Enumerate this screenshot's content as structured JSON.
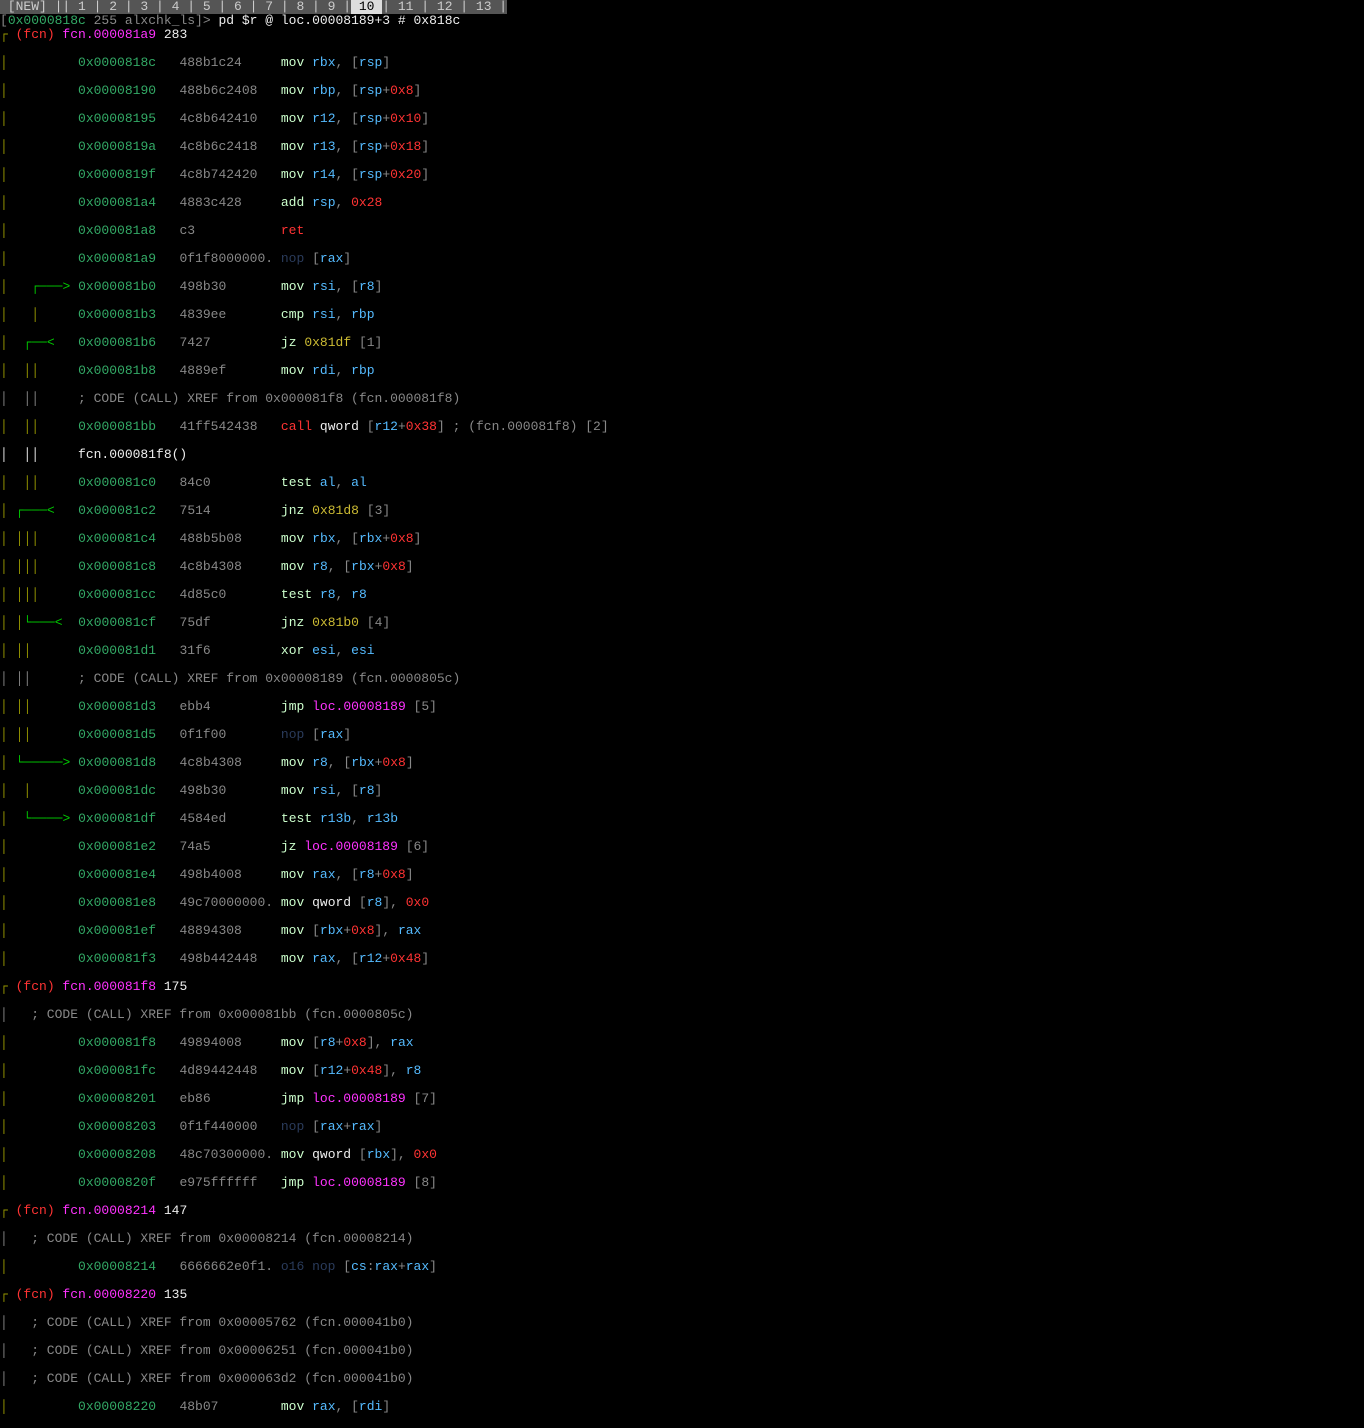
{
  "tabbar": {
    "prefix": " [NEW] |",
    "tabs": [
      " 1 ",
      " 2 ",
      " 3 ",
      " 4 ",
      " 5 ",
      " 6 ",
      " 7 ",
      " 8 ",
      " 9 "
    ],
    "active": " 10 ",
    "tabs_after": [
      " 11 ",
      " 12 ",
      " 13 "
    ]
  },
  "prompt": {
    "bracket_open": "[",
    "addr": "0x0000818c",
    "info": " 255 alxchk_ls]> ",
    "cmd": "pd $r @ loc.00008189+3 # 0x818c"
  },
  "fcn_headers": [
    {
      "prefix": "┌ ",
      "label": "(fcn) ",
      "name": "fcn.000081a9",
      "size": " 283"
    },
    {
      "prefix": "┌ ",
      "label": "(fcn) ",
      "name": "fcn.000081f8",
      "size": " 175"
    },
    {
      "prefix": "┌ ",
      "label": "(fcn) ",
      "name": "fcn.00008214",
      "size": " 147"
    },
    {
      "prefix": "┌ ",
      "label": "(fcn) ",
      "name": "fcn.00008220",
      "size": " 135"
    }
  ],
  "asm": {
    "lines": [
      {
        "g": "│         ",
        "a": "0x0000818c",
        "b": "   488b1c24     ",
        "m": "mov ",
        "ops": [
          [
            "reg",
            "rbx"
          ],
          [
            "txt",
            ", ["
          ],
          [
            "reg",
            "rsp"
          ],
          [
            "txt",
            "]"
          ]
        ]
      },
      {
        "g": "│         ",
        "a": "0x00008190",
        "b": "   488b6c2408   ",
        "m": "mov ",
        "ops": [
          [
            "reg",
            "rbp"
          ],
          [
            "txt",
            ", ["
          ],
          [
            "reg",
            "rsp"
          ],
          [
            "txt",
            "+"
          ],
          [
            "num",
            "0x8"
          ],
          [
            "txt",
            "]"
          ]
        ]
      },
      {
        "g": "│         ",
        "a": "0x00008195",
        "b": "   4c8b642410   ",
        "m": "mov ",
        "ops": [
          [
            "reg",
            "r12"
          ],
          [
            "txt",
            ", ["
          ],
          [
            "reg",
            "rsp"
          ],
          [
            "txt",
            "+"
          ],
          [
            "num",
            "0x10"
          ],
          [
            "txt",
            "]"
          ]
        ]
      },
      {
        "g": "│         ",
        "a": "0x0000819a",
        "b": "   4c8b6c2418   ",
        "m": "mov ",
        "ops": [
          [
            "reg",
            "r13"
          ],
          [
            "txt",
            ", ["
          ],
          [
            "reg",
            "rsp"
          ],
          [
            "txt",
            "+"
          ],
          [
            "num",
            "0x18"
          ],
          [
            "txt",
            "]"
          ]
        ]
      },
      {
        "g": "│         ",
        "a": "0x0000819f",
        "b": "   4c8b742420   ",
        "m": "mov ",
        "ops": [
          [
            "reg",
            "r14"
          ],
          [
            "txt",
            ", ["
          ],
          [
            "reg",
            "rsp"
          ],
          [
            "txt",
            "+"
          ],
          [
            "num",
            "0x20"
          ],
          [
            "txt",
            "]"
          ]
        ]
      },
      {
        "g": "│         ",
        "a": "0x000081a4",
        "b": "   4883c428     ",
        "m": "add ",
        "ops": [
          [
            "reg",
            "rsp"
          ],
          [
            "txt",
            ", "
          ],
          [
            "num",
            "0x28"
          ]
        ]
      },
      {
        "g": "│         ",
        "a": "0x000081a8",
        "b": "   c3           ",
        "m": "ret",
        "mclass": "red",
        "ops": []
      },
      {
        "g": "│         ",
        "a": "0x000081a9",
        "b": "   0f1f8000000. ",
        "m": "nop ",
        "mclass": "nop",
        "ops": [
          [
            "txt",
            "["
          ],
          [
            "reg",
            "rax"
          ],
          [
            "txt",
            "]"
          ]
        ]
      },
      {
        "g": "│   ┌───> ",
        "a": "0x000081b0",
        "b": "   498b30       ",
        "m": "mov ",
        "ops": [
          [
            "reg",
            "rsi"
          ],
          [
            "txt",
            ", ["
          ],
          [
            "reg",
            "r8"
          ],
          [
            "txt",
            "]"
          ]
        ]
      },
      {
        "g": "│   │     ",
        "a": "0x000081b3",
        "b": "   4839ee       ",
        "m": "cmp ",
        "ops": [
          [
            "reg",
            "rsi"
          ],
          [
            "txt",
            ", "
          ],
          [
            "reg",
            "rbp"
          ]
        ]
      },
      {
        "g": "│  ┌──< ",
        "gpad": "  ",
        "a": "0x000081b6",
        "b": "   7427         ",
        "m": "jz ",
        "ops": [
          [
            "ox",
            "0x81df"
          ],
          [
            "txt",
            " [1]"
          ]
        ]
      },
      {
        "g": "│  ││     ",
        "a": "0x000081b8",
        "b": "   4889ef       ",
        "m": "mov ",
        "ops": [
          [
            "reg",
            "rdi"
          ],
          [
            "txt",
            ", "
          ],
          [
            "reg",
            "rbp"
          ]
        ]
      },
      {
        "xref": "│  ││     ; CODE (CALL) XREF from 0x000081f8 (fcn.000081f8)"
      },
      {
        "g": "│  ││     ",
        "a": "0x000081bb",
        "b": "   41ff542438   ",
        "m": "call ",
        "mclass": "red",
        "ops": [
          [
            "wht",
            "qword"
          ],
          [
            "txt",
            " ["
          ],
          [
            "reg",
            "r12"
          ],
          [
            "txt",
            "+"
          ],
          [
            "num",
            "0x38"
          ],
          [
            "txt",
            "]"
          ],
          [
            "cmt",
            " ; (fcn.000081f8) [2]"
          ]
        ]
      },
      {
        "plain": "│  ││     fcn.000081f8()"
      },
      {
        "g": "│  ││     ",
        "a": "0x000081c0",
        "b": "   84c0         ",
        "m": "test ",
        "ops": [
          [
            "reg",
            "al"
          ],
          [
            "txt",
            ", "
          ],
          [
            "reg",
            "al"
          ]
        ]
      },
      {
        "g": "│ ┌───< ",
        "gpad": "  ",
        "a": "0x000081c2",
        "b": "   7514         ",
        "m": "jnz ",
        "ops": [
          [
            "ox",
            "0x81d8"
          ],
          [
            "txt",
            " [3]"
          ]
        ]
      },
      {
        "g": "│ │││     ",
        "a": "0x000081c4",
        "b": "   488b5b08     ",
        "m": "mov ",
        "ops": [
          [
            "reg",
            "rbx"
          ],
          [
            "txt",
            ", ["
          ],
          [
            "reg",
            "rbx"
          ],
          [
            "txt",
            "+"
          ],
          [
            "num",
            "0x8"
          ],
          [
            "txt",
            "]"
          ]
        ]
      },
      {
        "g": "│ │││     ",
        "a": "0x000081c8",
        "b": "   4c8b4308     ",
        "m": "mov ",
        "ops": [
          [
            "reg",
            "r8"
          ],
          [
            "txt",
            ", ["
          ],
          [
            "reg",
            "rbx"
          ],
          [
            "txt",
            "+"
          ],
          [
            "num",
            "0x8"
          ],
          [
            "txt",
            "]"
          ]
        ]
      },
      {
        "g": "│ │││     ",
        "a": "0x000081cc",
        "b": "   4d85c0       ",
        "m": "test ",
        "ops": [
          [
            "reg",
            "r8"
          ],
          [
            "txt",
            ", "
          ],
          [
            "reg",
            "r8"
          ]
        ]
      },
      {
        "g": "│ │└───< ",
        "gpad": " ",
        "a": "0x000081cf",
        "b": "   75df         ",
        "m": "jnz ",
        "ops": [
          [
            "ox",
            "0x81b0"
          ],
          [
            "txt",
            " [4]"
          ]
        ]
      },
      {
        "g": "│ ││      ",
        "a": "0x000081d1",
        "b": "   31f6         ",
        "m": "xor ",
        "ops": [
          [
            "reg",
            "esi"
          ],
          [
            "txt",
            ", "
          ],
          [
            "reg",
            "esi"
          ]
        ]
      },
      {
        "xref": "│ ││      ; CODE (CALL) XREF from 0x00008189 (fcn.0000805c)"
      },
      {
        "g": "│ ││      ",
        "a": "0x000081d3",
        "b": "   ebb4         ",
        "m": "jmp ",
        "ops": [
          [
            "fcn",
            "loc.00008189"
          ],
          [
            "txt",
            " [5]"
          ]
        ]
      },
      {
        "g": "│ ││      ",
        "a": "0x000081d5",
        "b": "   0f1f00       ",
        "m": "nop ",
        "mclass": "nop",
        "ops": [
          [
            "txt",
            "["
          ],
          [
            "reg",
            "rax"
          ],
          [
            "txt",
            "]"
          ]
        ]
      },
      {
        "g": "│ └─────> ",
        "a": "0x000081d8",
        "b": "   4c8b4308     ",
        "m": "mov ",
        "ops": [
          [
            "reg",
            "r8"
          ],
          [
            "txt",
            ", ["
          ],
          [
            "reg",
            "rbx"
          ],
          [
            "txt",
            "+"
          ],
          [
            "num",
            "0x8"
          ],
          [
            "txt",
            "]"
          ]
        ]
      },
      {
        "g": "│  │      ",
        "a": "0x000081dc",
        "b": "   498b30       ",
        "m": "mov ",
        "ops": [
          [
            "reg",
            "rsi"
          ],
          [
            "txt",
            ", ["
          ],
          [
            "reg",
            "r8"
          ],
          [
            "txt",
            "]"
          ]
        ]
      },
      {
        "g": "│  └────> ",
        "a": "0x000081df",
        "b": "   4584ed       ",
        "m": "test ",
        "ops": [
          [
            "reg",
            "r13b"
          ],
          [
            "txt",
            ", "
          ],
          [
            "reg",
            "r13b"
          ]
        ]
      },
      {
        "g": "│         ",
        "a": "0x000081e2",
        "b": "   74a5         ",
        "m": "jz ",
        "ops": [
          [
            "fcn",
            "loc.00008189"
          ],
          [
            "txt",
            " [6]"
          ]
        ]
      },
      {
        "g": "│         ",
        "a": "0x000081e4",
        "b": "   498b4008     ",
        "m": "mov ",
        "ops": [
          [
            "reg",
            "rax"
          ],
          [
            "txt",
            ", ["
          ],
          [
            "reg",
            "r8"
          ],
          [
            "txt",
            "+"
          ],
          [
            "num",
            "0x8"
          ],
          [
            "txt",
            "]"
          ]
        ]
      },
      {
        "g": "│         ",
        "a": "0x000081e8",
        "b": "   49c70000000. ",
        "m": "mov ",
        "ops": [
          [
            "wht",
            "qword"
          ],
          [
            "txt",
            " ["
          ],
          [
            "reg",
            "r8"
          ],
          [
            "txt",
            "], "
          ],
          [
            "num",
            "0x0"
          ]
        ]
      },
      {
        "g": "│         ",
        "a": "0x000081ef",
        "b": "   48894308     ",
        "m": "mov ",
        "ops": [
          [
            "txt",
            "["
          ],
          [
            "reg",
            "rbx"
          ],
          [
            "txt",
            "+"
          ],
          [
            "num",
            "0x8"
          ],
          [
            "txt",
            "], "
          ],
          [
            "reg",
            "rax"
          ]
        ]
      },
      {
        "g": "│         ",
        "a": "0x000081f3",
        "b": "   498b442448   ",
        "m": "mov ",
        "ops": [
          [
            "reg",
            "rax"
          ],
          [
            "txt",
            ", ["
          ],
          [
            "reg",
            "r12"
          ],
          [
            "txt",
            "+"
          ],
          [
            "num",
            "0x48"
          ],
          [
            "txt",
            "]"
          ]
        ]
      },
      {
        "xref": "│   ; CODE (CALL) XREF from 0x000081bb (fcn.0000805c)"
      },
      {
        "g": "│         ",
        "a": "0x000081f8",
        "b": "   49894008     ",
        "m": "mov ",
        "ops": [
          [
            "txt",
            "["
          ],
          [
            "reg",
            "r8"
          ],
          [
            "txt",
            "+"
          ],
          [
            "num",
            "0x8"
          ],
          [
            "txt",
            "], "
          ],
          [
            "reg",
            "rax"
          ]
        ]
      },
      {
        "g": "│         ",
        "a": "0x000081fc",
        "b": "   4d89442448   ",
        "m": "mov ",
        "ops": [
          [
            "txt",
            "["
          ],
          [
            "reg",
            "r12"
          ],
          [
            "txt",
            "+"
          ],
          [
            "num",
            "0x48"
          ],
          [
            "txt",
            "], "
          ],
          [
            "reg",
            "r8"
          ]
        ]
      },
      {
        "g": "│         ",
        "a": "0x00008201",
        "b": "   eb86         ",
        "m": "jmp ",
        "ops": [
          [
            "fcn",
            "loc.00008189"
          ],
          [
            "txt",
            " [7]"
          ]
        ]
      },
      {
        "g": "│         ",
        "a": "0x00008203",
        "b": "   0f1f440000   ",
        "m": "nop ",
        "mclass": "nop",
        "ops": [
          [
            "txt",
            "["
          ],
          [
            "reg",
            "rax"
          ],
          [
            "txt",
            "+"
          ],
          [
            "reg",
            "rax"
          ],
          [
            "txt",
            "]"
          ]
        ]
      },
      {
        "g": "│         ",
        "a": "0x00008208",
        "b": "   48c70300000. ",
        "m": "mov ",
        "ops": [
          [
            "wht",
            "qword"
          ],
          [
            "txt",
            " ["
          ],
          [
            "reg",
            "rbx"
          ],
          [
            "txt",
            "], "
          ],
          [
            "num",
            "0x0"
          ]
        ]
      },
      {
        "g": "│         ",
        "a": "0x0000820f",
        "b": "   e975ffffff   ",
        "m": "jmp ",
        "ops": [
          [
            "fcn",
            "loc.00008189"
          ],
          [
            "txt",
            " [8]"
          ]
        ]
      },
      {
        "xref": "│   ; CODE (CALL) XREF from 0x00008214 (fcn.00008214)"
      },
      {
        "g": "│         ",
        "a": "0x00008214",
        "b": "   6666662e0f1. ",
        "m": "o16 nop ",
        "mclass": "nop",
        "ops": [
          [
            "txt",
            "["
          ],
          [
            "seg",
            "cs"
          ],
          [
            "txt",
            ":"
          ],
          [
            "reg",
            "rax"
          ],
          [
            "txt",
            "+"
          ],
          [
            "reg",
            "rax"
          ],
          [
            "txt",
            "]"
          ]
        ]
      },
      {
        "xref": "│   ; CODE (CALL) XREF from 0x00005762 (fcn.000041b0)"
      },
      {
        "xref": "│   ; CODE (CALL) XREF from 0x00006251 (fcn.000041b0)"
      },
      {
        "xref": "│   ; CODE (CALL) XREF from 0x000063d2 (fcn.000041b0)"
      },
      {
        "g": "│         ",
        "a": "0x00008220",
        "b": "   48b07        ",
        "m": "mov ",
        "ops": [
          [
            "reg",
            "rax"
          ],
          [
            "txt",
            ", ["
          ],
          [
            "reg",
            "rdi"
          ],
          [
            "txt",
            "]"
          ]
        ]
      }
    ],
    "fcn_insert_after": {
      "0x000081f3": 0,
      "0x0000820f": 1,
      "0x00008214": 2
    }
  }
}
